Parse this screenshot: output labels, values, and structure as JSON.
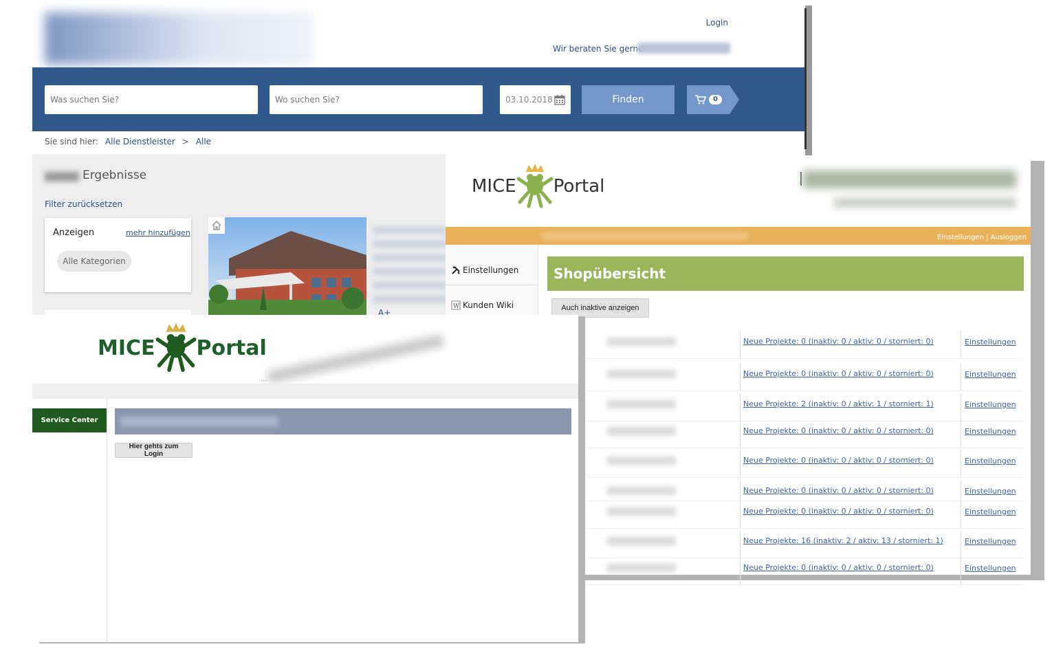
{
  "search_site": {
    "login": "Login",
    "consult_label": "Wir beraten Sie gerne",
    "what_placeholder": "Was suchen Sie?",
    "where_placeholder": "Wo suchen Sie?",
    "date": "03.10.2018",
    "find_label": "Finden",
    "cart_count": "0",
    "breadcrumb": {
      "prefix": "Sie sind hier:",
      "item1": "Alle Dienstleister",
      "separator": ">",
      "item2": "Alle"
    },
    "results_label": "Ergebnisse",
    "reset_filter": "Filter zurücksetzen",
    "filter": {
      "title": "Anzeigen",
      "more": "mehr hinzufügen",
      "all_categories": "Alle Kategorien"
    },
    "badge": "A+"
  },
  "mice_shop": {
    "logo_left": "MICE",
    "logo_right": "Portal",
    "top_actions": "Einstellungen | Ausloggen",
    "sidebar": [
      {
        "label": "Einstellungen",
        "icon": "tools-icon"
      },
      {
        "label": "Kunden Wiki",
        "icon": "wiki-icon"
      }
    ],
    "title": "Shopübersicht",
    "inactive_button": "Auch inaktive anzeigen",
    "rows": [
      {
        "projects": "Neue Projekte: 0 (inaktiv: 0 / aktiv: 0 / storniert: 0)",
        "settings": "Einstellungen"
      },
      {
        "projects": "Neue Projekte: 0 (inaktiv: 0 / aktiv: 0 / storniert: 0)",
        "settings": "Einstellungen"
      },
      {
        "projects": "Neue Projekte: 2 (inaktiv: 0 / aktiv: 1 / storniert: 1)",
        "settings": "Einstellungen"
      },
      {
        "projects": "Neue Projekte: 0 (inaktiv: 0 / aktiv: 0 / storniert: 0)",
        "settings": "Einstellungen"
      },
      {
        "projects": "Neue Projekte: 0 (inaktiv: 0 / aktiv: 0 / storniert: 0)",
        "settings": "Einstellungen"
      },
      {
        "projects": "Neue Projekte: 0 (inaktiv: 0 / aktiv: 0 / storniert: 0)",
        "settings": "Einstellungen"
      },
      {
        "projects": "Neue Projekte: 0 (inaktiv: 0 / aktiv: 0 / storniert: 0)",
        "settings": "Einstellungen"
      },
      {
        "projects": "Neue Projekte: 16 (inaktiv: 2 / aktiv: 13 / storniert: 1)",
        "settings": "Einstellungen"
      },
      {
        "projects": "Neue Projekte: 0 (inaktiv: 0 / aktiv: 0 / storniert: 0)",
        "settings": "Einstellungen"
      }
    ]
  },
  "mice_service": {
    "logo_left": "MICE",
    "logo_right": "Portal",
    "service_center": "Service Center",
    "login_button": "Hier gehts zum Login",
    "dots": "..."
  },
  "colors": {
    "search_blue": "#305a8c",
    "button_blue": "#7399cc",
    "mice_green": "#9bb65a",
    "mice_orange": "#e8b15a",
    "service_green": "#1f5a1f"
  }
}
